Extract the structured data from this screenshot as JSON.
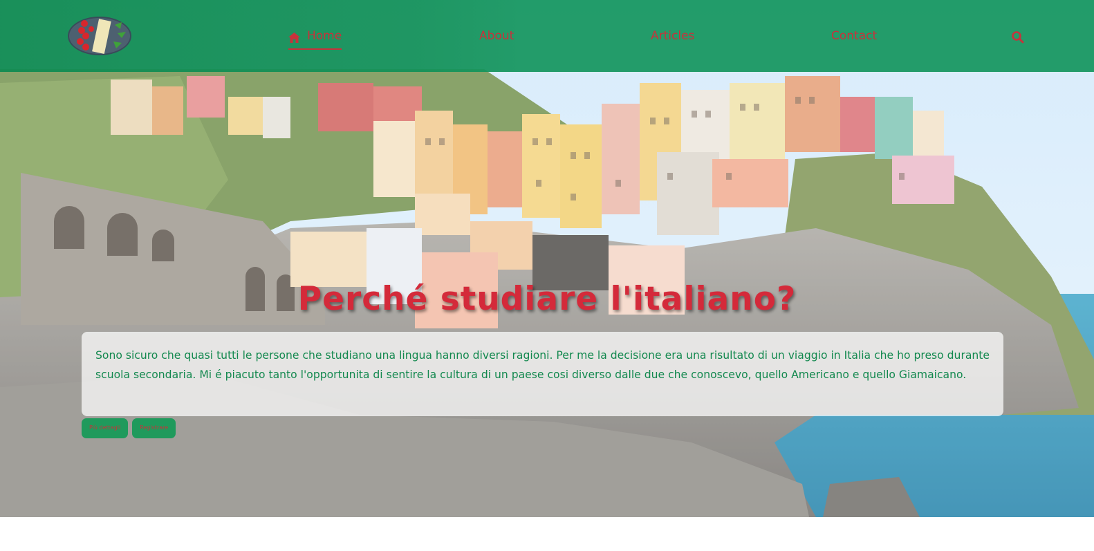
{
  "nav": {
    "home_label": "Home",
    "about_label": "About",
    "articles_label": "Articles",
    "contact_label": "Contact",
    "icons": {
      "home": "home-icon",
      "search": "search-icon",
      "logo": "logo-icon"
    }
  },
  "hero": {
    "title": "Perché studiare l'italiano?",
    "paragraph": "Sono sicuro che quasi tutti le persone che studiano una lingua hanno diversi ragioni. Per me la decisione era una risultato di un viaggio in Italia che ho preso durante scuola secondaria. Mi é piacuto tanto l'opportunita di sentire la cultura di un paese cosi diverso dalle due che conoscevo, quello Americano e quello Giamaicano.",
    "buttons": [
      "Più dettagli",
      "Registrare"
    ]
  },
  "colors": {
    "nav_bg": "#14965f",
    "accent_red": "#c8323b",
    "title_red": "#d42a3a",
    "text_green": "#12884e",
    "button_bg": "#1f9a5c"
  }
}
